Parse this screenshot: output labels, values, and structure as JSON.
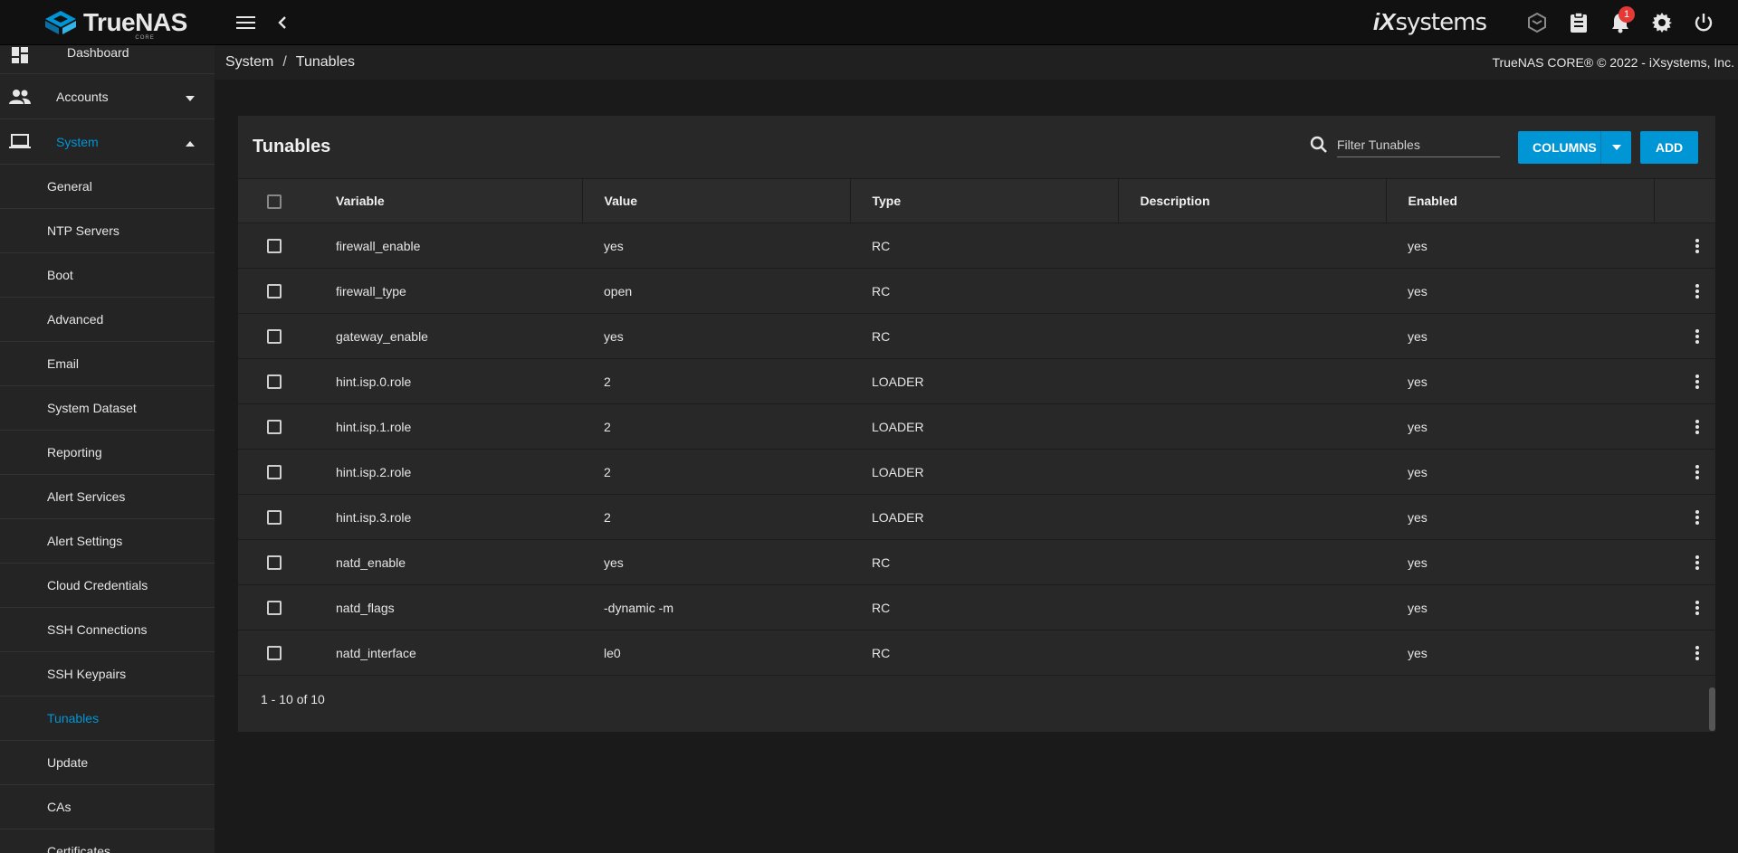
{
  "header": {
    "logo_text": "TrueNAS",
    "logo_subtext": "CORE",
    "vendor_ix": "iX",
    "vendor_systems": "systems",
    "notification_count": "1"
  },
  "breadcrumb": {
    "parent": "System",
    "separator": "/",
    "current": "Tunables",
    "copyright": "TrueNAS CORE® © 2022 - iXsystems, Inc."
  },
  "sidebar": {
    "top_items": [
      {
        "label": "Dashboard",
        "icon": "dashboard-icon"
      },
      {
        "label": "Accounts",
        "icon": "people-icon"
      },
      {
        "label": "System",
        "icon": "laptop-icon"
      }
    ],
    "sub_items": [
      {
        "label": "General"
      },
      {
        "label": "NTP Servers"
      },
      {
        "label": "Boot"
      },
      {
        "label": "Advanced"
      },
      {
        "label": "Email"
      },
      {
        "label": "System Dataset"
      },
      {
        "label": "Reporting"
      },
      {
        "label": "Alert Services"
      },
      {
        "label": "Alert Settings"
      },
      {
        "label": "Cloud Credentials"
      },
      {
        "label": "SSH Connections"
      },
      {
        "label": "SSH Keypairs"
      },
      {
        "label": "Tunables"
      },
      {
        "label": "Update"
      },
      {
        "label": "CAs"
      },
      {
        "label": "Certificates"
      }
    ],
    "active_item": "Tunables",
    "accent_color": "#0095d5"
  },
  "card": {
    "title": "Tunables",
    "filter_placeholder": "Filter Tunables",
    "columns_button": "COLUMNS",
    "add_button": "ADD",
    "pagination": "1 - 10 of 10"
  },
  "table": {
    "headers": [
      "Variable",
      "Value",
      "Type",
      "Description",
      "Enabled"
    ],
    "rows": [
      {
        "variable": "firewall_enable",
        "value": "yes",
        "type": "RC",
        "description": "",
        "enabled": "yes"
      },
      {
        "variable": "firewall_type",
        "value": "open",
        "type": "RC",
        "description": "",
        "enabled": "yes"
      },
      {
        "variable": "gateway_enable",
        "value": "yes",
        "type": "RC",
        "description": "",
        "enabled": "yes"
      },
      {
        "variable": "hint.isp.0.role",
        "value": "2",
        "type": "LOADER",
        "description": "",
        "enabled": "yes"
      },
      {
        "variable": "hint.isp.1.role",
        "value": "2",
        "type": "LOADER",
        "description": "",
        "enabled": "yes"
      },
      {
        "variable": "hint.isp.2.role",
        "value": "2",
        "type": "LOADER",
        "description": "",
        "enabled": "yes"
      },
      {
        "variable": "hint.isp.3.role",
        "value": "2",
        "type": "LOADER",
        "description": "",
        "enabled": "yes"
      },
      {
        "variable": "natd_enable",
        "value": "yes",
        "type": "RC",
        "description": "",
        "enabled": "yes"
      },
      {
        "variable": "natd_flags",
        "value": "-dynamic -m",
        "type": "RC",
        "description": "",
        "enabled": "yes"
      },
      {
        "variable": "natd_interface",
        "value": "le0",
        "type": "RC",
        "description": "",
        "enabled": "yes"
      }
    ]
  }
}
